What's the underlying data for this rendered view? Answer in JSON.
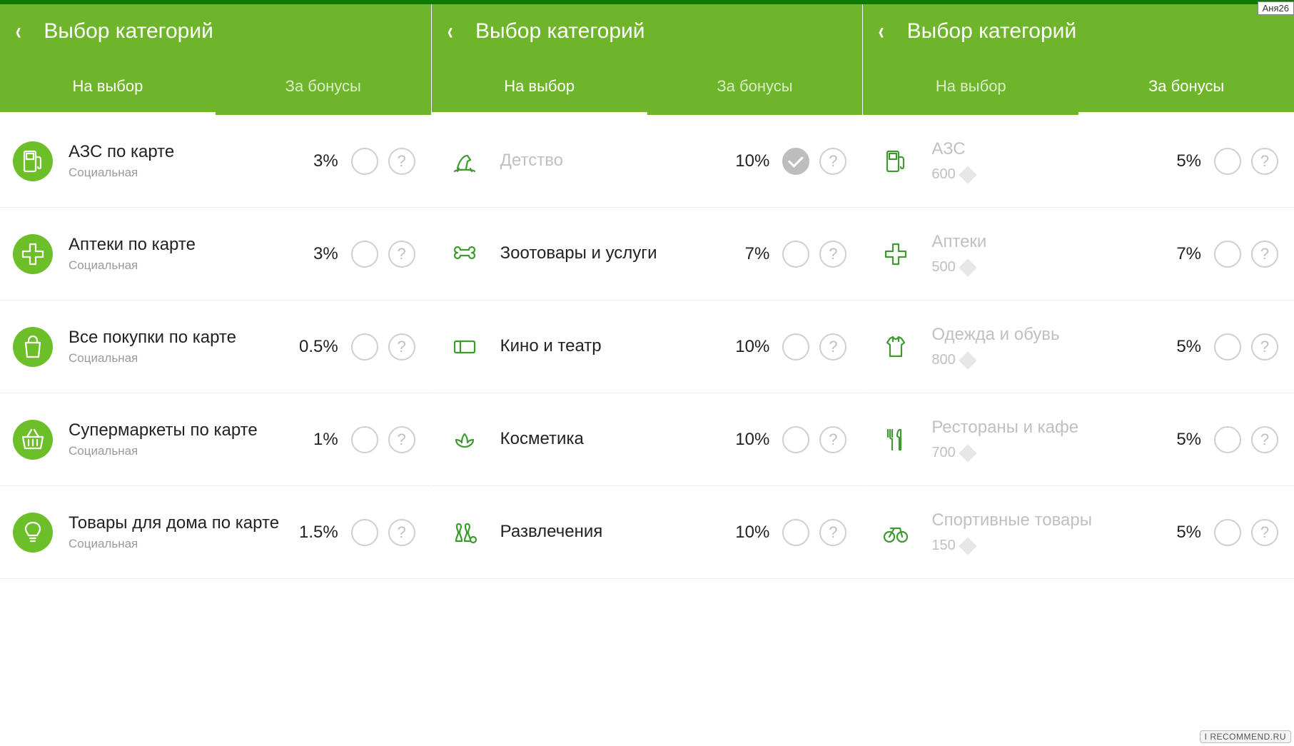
{
  "user_badge": "Аня26",
  "watermark": "I RECOMMEND.RU",
  "panels": [
    {
      "title": "Выбор категорий",
      "tabs": [
        {
          "label": "На выбор",
          "active": true
        },
        {
          "label": "За бонусы",
          "active": false
        }
      ],
      "rows": [
        {
          "icon": "gas-icon",
          "style": "circle",
          "title": "АЗС по карте",
          "subtitle": "Социальная",
          "percent": "3%",
          "checked": false,
          "dimmed": false
        },
        {
          "icon": "cross-icon",
          "style": "circle",
          "title": "Аптеки по карте",
          "subtitle": "Социальная",
          "percent": "3%",
          "checked": false,
          "dimmed": false
        },
        {
          "icon": "bag-icon",
          "style": "circle",
          "title": "Все покупки по карте",
          "subtitle": "Социальная",
          "percent": "0.5%",
          "checked": false,
          "dimmed": false
        },
        {
          "icon": "basket-icon",
          "style": "circle",
          "title": "Супермаркеты по карте",
          "subtitle": "Социальная",
          "percent": "1%",
          "checked": false,
          "dimmed": false
        },
        {
          "icon": "lamp-icon",
          "style": "circle",
          "title": "Товары для дома по карте",
          "subtitle": "Социальная",
          "percent": "1.5%",
          "checked": false,
          "dimmed": false
        }
      ]
    },
    {
      "title": "Выбор категорий",
      "tabs": [
        {
          "label": "На выбор",
          "active": true
        },
        {
          "label": "За бонусы",
          "active": false
        }
      ],
      "rows": [
        {
          "icon": "horse-icon",
          "style": "outline",
          "title": "Детство",
          "subtitle": "",
          "percent": "10%",
          "checked": true,
          "dimmed": true
        },
        {
          "icon": "bone-icon",
          "style": "outline",
          "title": "Зоотовары и услуги",
          "subtitle": "",
          "percent": "7%",
          "checked": false,
          "dimmed": false
        },
        {
          "icon": "ticket-icon",
          "style": "outline",
          "title": "Кино и театр",
          "subtitle": "",
          "percent": "10%",
          "checked": false,
          "dimmed": false
        },
        {
          "icon": "lotus-icon",
          "style": "outline",
          "title": "Косметика",
          "subtitle": "",
          "percent": "10%",
          "checked": false,
          "dimmed": false
        },
        {
          "icon": "bowling-icon",
          "style": "outline",
          "title": "Развлечения",
          "subtitle": "",
          "percent": "10%",
          "checked": false,
          "dimmed": false
        }
      ]
    },
    {
      "title": "Выбор категорий",
      "tabs": [
        {
          "label": "На выбор",
          "active": false
        },
        {
          "label": "За бонусы",
          "active": true
        }
      ],
      "rows": [
        {
          "icon": "gas-icon",
          "style": "outline",
          "title": "АЗС",
          "cost": "600",
          "percent": "5%",
          "checked": false,
          "dimmed": true
        },
        {
          "icon": "cross-icon",
          "style": "outline",
          "title": "Аптеки",
          "cost": "500",
          "percent": "7%",
          "checked": false,
          "dimmed": true
        },
        {
          "icon": "shirt-icon",
          "style": "outline",
          "title": "Одежда и обувь",
          "cost": "800",
          "percent": "5%",
          "checked": false,
          "dimmed": true
        },
        {
          "icon": "cutlery-icon",
          "style": "outline",
          "title": "Рестораны и кафе",
          "cost": "700",
          "percent": "5%",
          "checked": false,
          "dimmed": true
        },
        {
          "icon": "bicycle-icon",
          "style": "outline",
          "title": "Спортивные товары",
          "cost": "150",
          "percent": "5%",
          "checked": false,
          "dimmed": true
        }
      ]
    }
  ],
  "help_glyph": "?"
}
